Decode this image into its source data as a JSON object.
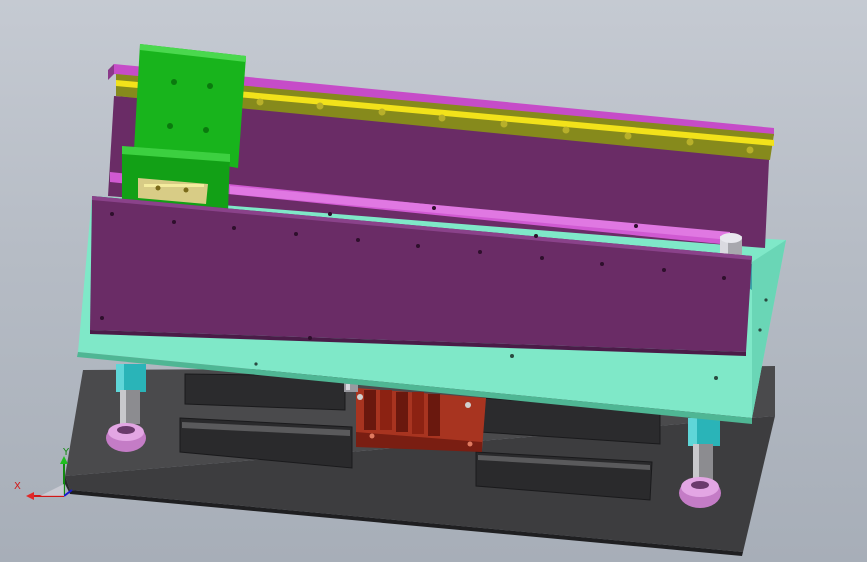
{
  "viewport": {
    "background": "#b8bec7"
  },
  "triad": {
    "x_label": "X",
    "y_label": "Y",
    "x_color": "#d01818",
    "y_color": "#128a12",
    "z_color": "#1a1ad0"
  },
  "colors": {
    "base_plate": "#3d3d3f",
    "top_plate": "#7fe8c8",
    "side_walls": "#6a2c66",
    "rail": "#868a1c",
    "rail_stripe": "#f2e21a",
    "slide_block": "#18b41c",
    "pneumatic_cylinder": "#8a2418",
    "guide_post_bushing": "#2ab4b8",
    "guide_post_nut": "#d48ad6"
  }
}
